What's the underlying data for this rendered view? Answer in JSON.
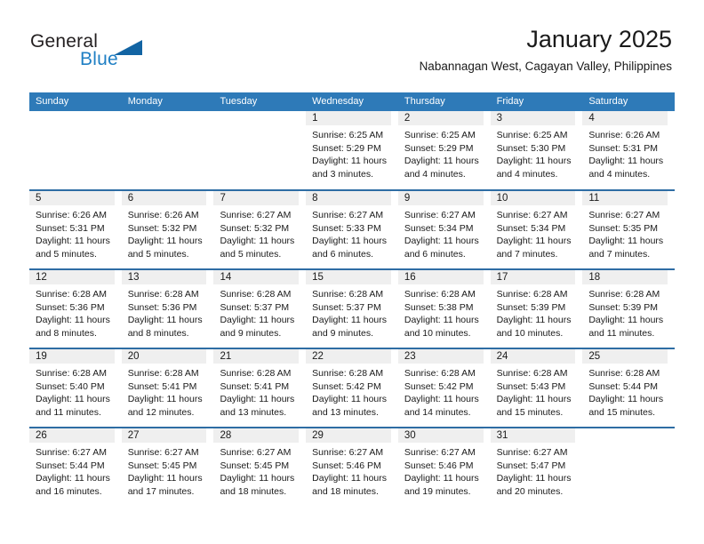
{
  "brand": {
    "name_part1": "General",
    "name_part2": "Blue",
    "accent_color": "#1f7fc4",
    "logo_triangle_color": "#1264a3"
  },
  "header": {
    "title": "January 2025",
    "subtitle": "Nabannagan West, Cagayan Valley, Philippines"
  },
  "calendar": {
    "header_bg": "#2e7ab8",
    "row_separator_color": "#2e6da4",
    "day_band_bg": "#efefef",
    "weekdays": [
      "Sunday",
      "Monday",
      "Tuesday",
      "Wednesday",
      "Thursday",
      "Friday",
      "Saturday"
    ],
    "weeks": [
      [
        {
          "day": "",
          "sunrise": "",
          "sunset": "",
          "daylight_line1": "",
          "daylight_line2": "",
          "blank": true
        },
        {
          "day": "",
          "sunrise": "",
          "sunset": "",
          "daylight_line1": "",
          "daylight_line2": "",
          "blank": true
        },
        {
          "day": "",
          "sunrise": "",
          "sunset": "",
          "daylight_line1": "",
          "daylight_line2": "",
          "blank": true
        },
        {
          "day": "1",
          "sunrise": "Sunrise: 6:25 AM",
          "sunset": "Sunset: 5:29 PM",
          "daylight_line1": "Daylight: 11 hours",
          "daylight_line2": "and 3 minutes."
        },
        {
          "day": "2",
          "sunrise": "Sunrise: 6:25 AM",
          "sunset": "Sunset: 5:29 PM",
          "daylight_line1": "Daylight: 11 hours",
          "daylight_line2": "and 4 minutes."
        },
        {
          "day": "3",
          "sunrise": "Sunrise: 6:25 AM",
          "sunset": "Sunset: 5:30 PM",
          "daylight_line1": "Daylight: 11 hours",
          "daylight_line2": "and 4 minutes."
        },
        {
          "day": "4",
          "sunrise": "Sunrise: 6:26 AM",
          "sunset": "Sunset: 5:31 PM",
          "daylight_line1": "Daylight: 11 hours",
          "daylight_line2": "and 4 minutes."
        }
      ],
      [
        {
          "day": "5",
          "sunrise": "Sunrise: 6:26 AM",
          "sunset": "Sunset: 5:31 PM",
          "daylight_line1": "Daylight: 11 hours",
          "daylight_line2": "and 5 minutes."
        },
        {
          "day": "6",
          "sunrise": "Sunrise: 6:26 AM",
          "sunset": "Sunset: 5:32 PM",
          "daylight_line1": "Daylight: 11 hours",
          "daylight_line2": "and 5 minutes."
        },
        {
          "day": "7",
          "sunrise": "Sunrise: 6:27 AM",
          "sunset": "Sunset: 5:32 PM",
          "daylight_line1": "Daylight: 11 hours",
          "daylight_line2": "and 5 minutes."
        },
        {
          "day": "8",
          "sunrise": "Sunrise: 6:27 AM",
          "sunset": "Sunset: 5:33 PM",
          "daylight_line1": "Daylight: 11 hours",
          "daylight_line2": "and 6 minutes."
        },
        {
          "day": "9",
          "sunrise": "Sunrise: 6:27 AM",
          "sunset": "Sunset: 5:34 PM",
          "daylight_line1": "Daylight: 11 hours",
          "daylight_line2": "and 6 minutes."
        },
        {
          "day": "10",
          "sunrise": "Sunrise: 6:27 AM",
          "sunset": "Sunset: 5:34 PM",
          "daylight_line1": "Daylight: 11 hours",
          "daylight_line2": "and 7 minutes."
        },
        {
          "day": "11",
          "sunrise": "Sunrise: 6:27 AM",
          "sunset": "Sunset: 5:35 PM",
          "daylight_line1": "Daylight: 11 hours",
          "daylight_line2": "and 7 minutes."
        }
      ],
      [
        {
          "day": "12",
          "sunrise": "Sunrise: 6:28 AM",
          "sunset": "Sunset: 5:36 PM",
          "daylight_line1": "Daylight: 11 hours",
          "daylight_line2": "and 8 minutes."
        },
        {
          "day": "13",
          "sunrise": "Sunrise: 6:28 AM",
          "sunset": "Sunset: 5:36 PM",
          "daylight_line1": "Daylight: 11 hours",
          "daylight_line2": "and 8 minutes."
        },
        {
          "day": "14",
          "sunrise": "Sunrise: 6:28 AM",
          "sunset": "Sunset: 5:37 PM",
          "daylight_line1": "Daylight: 11 hours",
          "daylight_line2": "and 9 minutes."
        },
        {
          "day": "15",
          "sunrise": "Sunrise: 6:28 AM",
          "sunset": "Sunset: 5:37 PM",
          "daylight_line1": "Daylight: 11 hours",
          "daylight_line2": "and 9 minutes."
        },
        {
          "day": "16",
          "sunrise": "Sunrise: 6:28 AM",
          "sunset": "Sunset: 5:38 PM",
          "daylight_line1": "Daylight: 11 hours",
          "daylight_line2": "and 10 minutes."
        },
        {
          "day": "17",
          "sunrise": "Sunrise: 6:28 AM",
          "sunset": "Sunset: 5:39 PM",
          "daylight_line1": "Daylight: 11 hours",
          "daylight_line2": "and 10 minutes."
        },
        {
          "day": "18",
          "sunrise": "Sunrise: 6:28 AM",
          "sunset": "Sunset: 5:39 PM",
          "daylight_line1": "Daylight: 11 hours",
          "daylight_line2": "and 11 minutes."
        }
      ],
      [
        {
          "day": "19",
          "sunrise": "Sunrise: 6:28 AM",
          "sunset": "Sunset: 5:40 PM",
          "daylight_line1": "Daylight: 11 hours",
          "daylight_line2": "and 11 minutes."
        },
        {
          "day": "20",
          "sunrise": "Sunrise: 6:28 AM",
          "sunset": "Sunset: 5:41 PM",
          "daylight_line1": "Daylight: 11 hours",
          "daylight_line2": "and 12 minutes."
        },
        {
          "day": "21",
          "sunrise": "Sunrise: 6:28 AM",
          "sunset": "Sunset: 5:41 PM",
          "daylight_line1": "Daylight: 11 hours",
          "daylight_line2": "and 13 minutes."
        },
        {
          "day": "22",
          "sunrise": "Sunrise: 6:28 AM",
          "sunset": "Sunset: 5:42 PM",
          "daylight_line1": "Daylight: 11 hours",
          "daylight_line2": "and 13 minutes."
        },
        {
          "day": "23",
          "sunrise": "Sunrise: 6:28 AM",
          "sunset": "Sunset: 5:42 PM",
          "daylight_line1": "Daylight: 11 hours",
          "daylight_line2": "and 14 minutes."
        },
        {
          "day": "24",
          "sunrise": "Sunrise: 6:28 AM",
          "sunset": "Sunset: 5:43 PM",
          "daylight_line1": "Daylight: 11 hours",
          "daylight_line2": "and 15 minutes."
        },
        {
          "day": "25",
          "sunrise": "Sunrise: 6:28 AM",
          "sunset": "Sunset: 5:44 PM",
          "daylight_line1": "Daylight: 11 hours",
          "daylight_line2": "and 15 minutes."
        }
      ],
      [
        {
          "day": "26",
          "sunrise": "Sunrise: 6:27 AM",
          "sunset": "Sunset: 5:44 PM",
          "daylight_line1": "Daylight: 11 hours",
          "daylight_line2": "and 16 minutes."
        },
        {
          "day": "27",
          "sunrise": "Sunrise: 6:27 AM",
          "sunset": "Sunset: 5:45 PM",
          "daylight_line1": "Daylight: 11 hours",
          "daylight_line2": "and 17 minutes."
        },
        {
          "day": "28",
          "sunrise": "Sunrise: 6:27 AM",
          "sunset": "Sunset: 5:45 PM",
          "daylight_line1": "Daylight: 11 hours",
          "daylight_line2": "and 18 minutes."
        },
        {
          "day": "29",
          "sunrise": "Sunrise: 6:27 AM",
          "sunset": "Sunset: 5:46 PM",
          "daylight_line1": "Daylight: 11 hours",
          "daylight_line2": "and 18 minutes."
        },
        {
          "day": "30",
          "sunrise": "Sunrise: 6:27 AM",
          "sunset": "Sunset: 5:46 PM",
          "daylight_line1": "Daylight: 11 hours",
          "daylight_line2": "and 19 minutes."
        },
        {
          "day": "31",
          "sunrise": "Sunrise: 6:27 AM",
          "sunset": "Sunset: 5:47 PM",
          "daylight_line1": "Daylight: 11 hours",
          "daylight_line2": "and 20 minutes."
        },
        {
          "day": "",
          "sunrise": "",
          "sunset": "",
          "daylight_line1": "",
          "daylight_line2": "",
          "blank": true
        }
      ]
    ]
  }
}
